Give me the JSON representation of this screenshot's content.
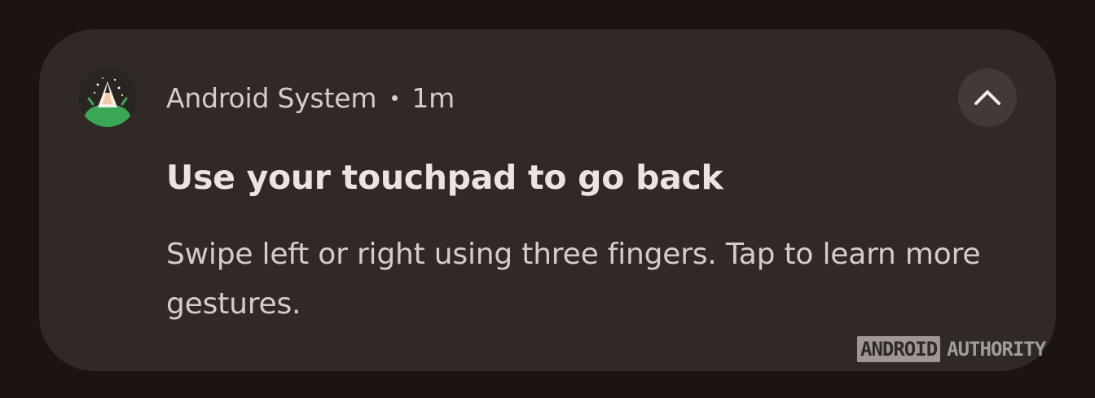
{
  "notification": {
    "app_name": "Android System",
    "time": "1m",
    "title": "Use your touchpad to go back",
    "body": "Swipe left or right using three fingers. Tap to learn more gestures.",
    "app_icon": "android-launch-icon",
    "collapse_icon": "chevron-up-icon"
  },
  "watermark": {
    "part1": "ANDROID",
    "part2": "AUTHORITY"
  },
  "colors": {
    "background": "#1b1413",
    "card": "#302925",
    "button": "#423a36",
    "text_primary": "#efe3df",
    "text_secondary": "#d7ccc8",
    "android_green": "#3aa757"
  }
}
